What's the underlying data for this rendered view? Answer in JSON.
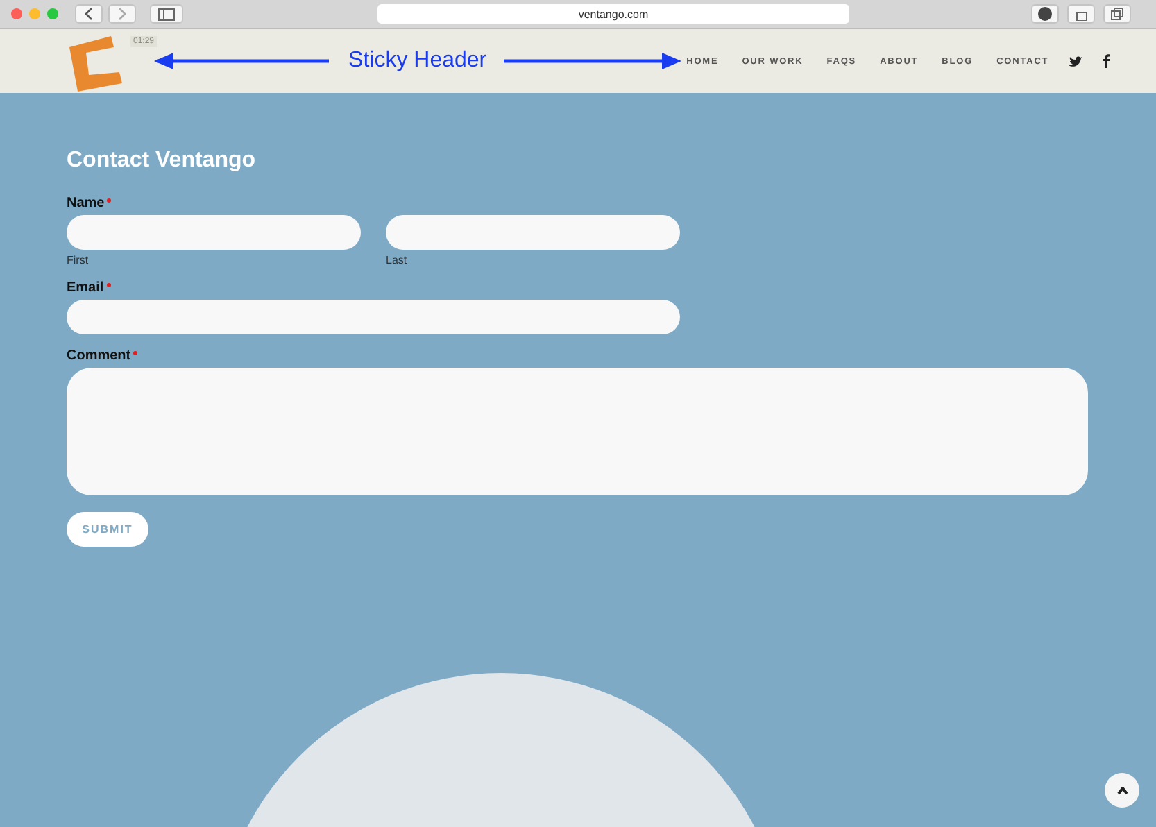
{
  "browser": {
    "url": "ventango.com"
  },
  "header": {
    "video_time": "01:29",
    "annotation": "Sticky Header",
    "nav": [
      {
        "label": "HOME"
      },
      {
        "label": "OUR WORK"
      },
      {
        "label": "FAQS"
      },
      {
        "label": "ABOUT"
      },
      {
        "label": "BLOG"
      },
      {
        "label": "CONTACT"
      }
    ]
  },
  "form": {
    "title": "Contact Ventango",
    "fields": [
      {
        "kind": "name",
        "label": "Name",
        "required": true,
        "sublabels": [
          "First",
          "Last"
        ]
      },
      {
        "kind": "text",
        "label": "Email",
        "required": true
      },
      {
        "kind": "textarea",
        "label": "Comment",
        "required": true
      }
    ],
    "submit": "SUBMIT"
  }
}
